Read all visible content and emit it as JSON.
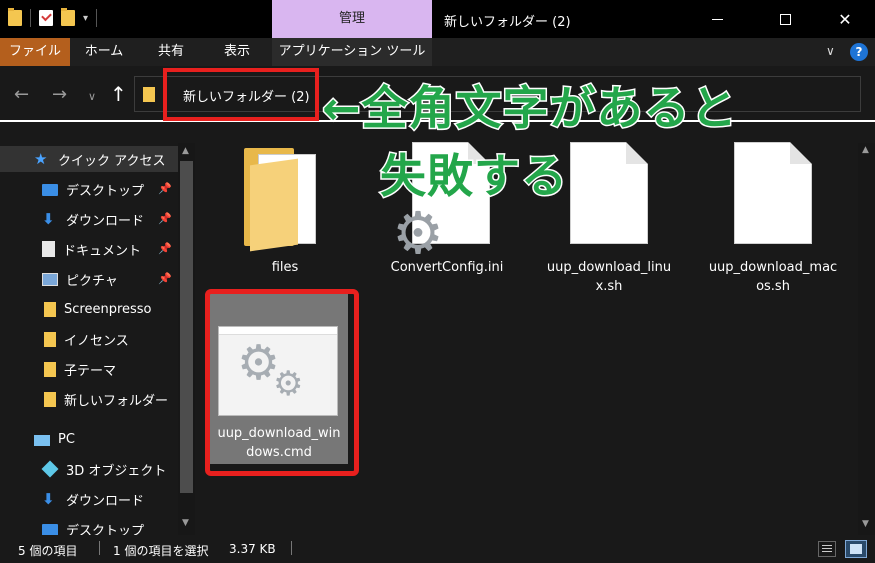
{
  "titlebar": {
    "manage_tab": "管理",
    "window_title": "新しいフォルダー (2)",
    "dropdown_glyph": "▾",
    "minimize_icon": "minimize-icon",
    "maximize_icon": "maximize-icon",
    "close_glyph": "✕"
  },
  "ribbon": {
    "tabs": [
      "ファイル",
      "ホーム",
      "共有",
      "表示",
      "アプリケーション ツール"
    ],
    "file_tab_color": "#b45f1d",
    "expand_glyph": "∨",
    "help_glyph": "?"
  },
  "nav": {
    "back_glyph": "←",
    "forward_glyph": "→",
    "recent_glyph": "∨",
    "up_glyph": "↑",
    "address": "新しいフォルダー (2)"
  },
  "annotation": {
    "line1": "←全角文字があると",
    "line2": "失敗する",
    "color": "#23a64a",
    "highlight_color": "#e8201e"
  },
  "sidebar": {
    "items": [
      {
        "label": "クイック アクセス",
        "icon": "star-icon",
        "pinned": false
      },
      {
        "label": "デスクトップ",
        "icon": "desktop-icon",
        "pinned": true
      },
      {
        "label": "ダウンロード",
        "icon": "download-icon",
        "pinned": true
      },
      {
        "label": "ドキュメント",
        "icon": "document-icon",
        "pinned": true
      },
      {
        "label": "ピクチャ",
        "icon": "pictures-icon",
        "pinned": true
      },
      {
        "label": "Screenpresso",
        "icon": "folder-icon",
        "pinned": false
      },
      {
        "label": "イノセンス",
        "icon": "folder-icon",
        "pinned": false
      },
      {
        "label": "子テーマ",
        "icon": "folder-icon",
        "pinned": false
      },
      {
        "label": "新しいフォルダー",
        "icon": "folder-icon",
        "pinned": false
      },
      {
        "label": "PC",
        "icon": "pc-icon",
        "pinned": false
      },
      {
        "label": "3D オブジェクト",
        "icon": "3d-objects-icon",
        "pinned": false
      },
      {
        "label": "ダウンロード",
        "icon": "download-icon",
        "pinned": false
      },
      {
        "label": "デスクトップ",
        "icon": "desktop-icon",
        "pinned": false
      }
    ],
    "pin_glyph": "📌"
  },
  "files": [
    {
      "name": "files",
      "type": "folder"
    },
    {
      "name": "ConvertConfig.ini",
      "type": "settings"
    },
    {
      "name": "uup_download_linux.sh",
      "type": "document"
    },
    {
      "name": "uup_download_macos.sh",
      "type": "document"
    },
    {
      "name": "uup_download_windows.cmd",
      "type": "command",
      "selected": true
    }
  ],
  "statusbar": {
    "item_count": "5 個の項目",
    "selection": "1 個の項目を選択",
    "size": "3.37 KB"
  }
}
